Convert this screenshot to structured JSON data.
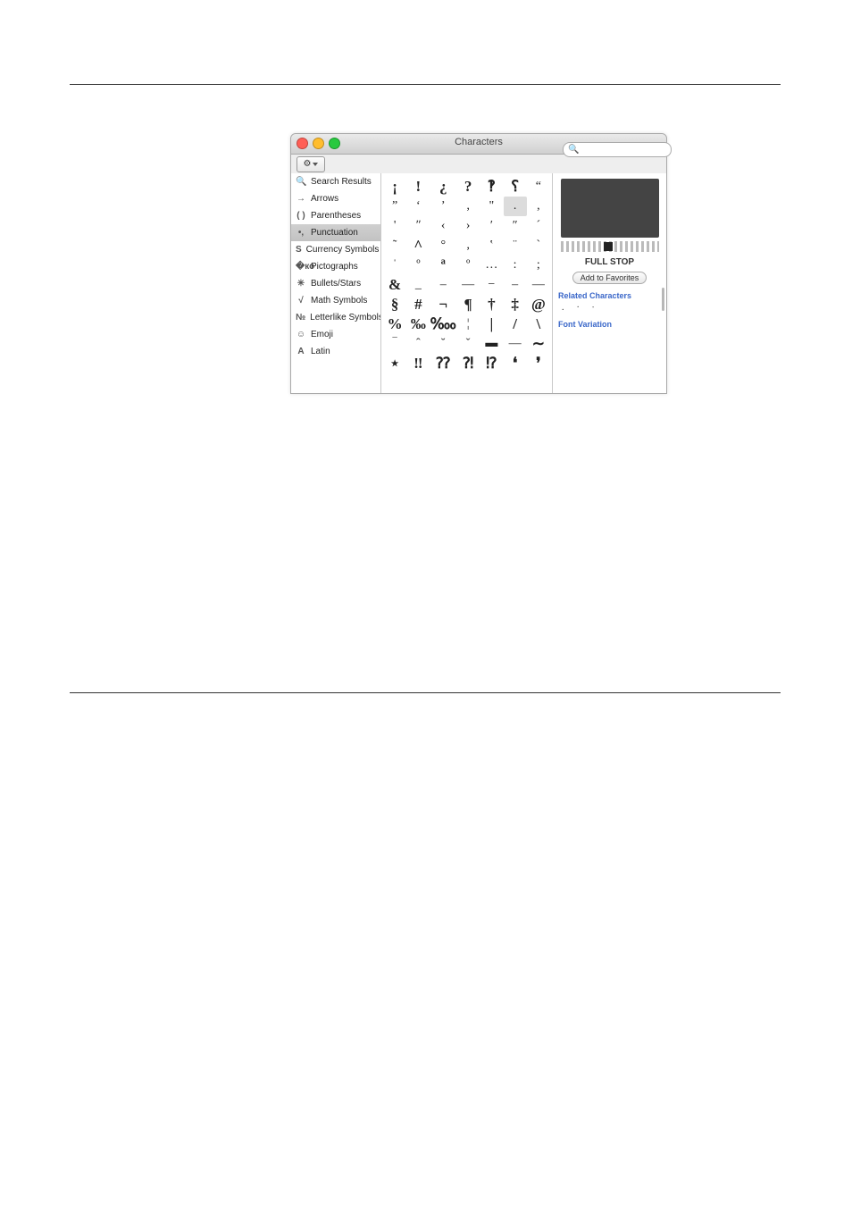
{
  "window": {
    "title": "Characters"
  },
  "search": {
    "placeholder": ""
  },
  "sidebar": {
    "items": [
      {
        "icon": "🔍",
        "label": "Search Results",
        "selected": false,
        "iconName": "search-icon"
      },
      {
        "icon": "→",
        "label": "Arrows",
        "selected": false,
        "iconName": "arrow-icon"
      },
      {
        "icon": "( )",
        "label": "Parentheses",
        "selected": false,
        "iconName": "parentheses-icon"
      },
      {
        "icon": "•,",
        "label": "Punctuation",
        "selected": true,
        "iconName": "punctuation-icon"
      },
      {
        "icon": "S",
        "label": "Currency Symbols",
        "selected": false,
        "iconName": "currency-icon"
      },
      {
        "icon": "�ко",
        "label": "Pictographs",
        "selected": false,
        "iconName": "pictograph-icon"
      },
      {
        "icon": "✳︎",
        "label": "Bullets/Stars",
        "selected": false,
        "iconName": "bullets-icon"
      },
      {
        "icon": "√",
        "label": "Math Symbols",
        "selected": false,
        "iconName": "math-icon"
      },
      {
        "icon": "№",
        "label": "Letterlike Symbols",
        "selected": false,
        "iconName": "letterlike-icon"
      },
      {
        "icon": "☺︎",
        "label": "Emoji",
        "selected": false,
        "iconName": "emoji-icon"
      },
      {
        "icon": "A",
        "label": "Latin",
        "selected": false,
        "iconName": "latin-icon"
      }
    ]
  },
  "grid": [
    {
      "c": "¡",
      "big": true
    },
    {
      "c": "!",
      "big": true
    },
    {
      "c": "¿",
      "big": true
    },
    {
      "c": "?",
      "big": true
    },
    {
      "c": "‽",
      "big": true
    },
    {
      "c": "⸮",
      "big": true
    },
    {
      "c": "“"
    },
    {
      "c": "”"
    },
    {
      "c": "‘"
    },
    {
      "c": "’"
    },
    {
      "c": "‚"
    },
    {
      "c": "\""
    },
    {
      "c": ".",
      "sel": true
    },
    {
      "c": ","
    },
    {
      "c": "'"
    },
    {
      "c": "ʺ"
    },
    {
      "c": "‹"
    },
    {
      "c": "›"
    },
    {
      "c": "′"
    },
    {
      "c": "″"
    },
    {
      "c": "´"
    },
    {
      "c": "˜"
    },
    {
      "c": "^",
      "big": true
    },
    {
      "c": "°"
    },
    {
      "c": "‚"
    },
    {
      "c": "‛"
    },
    {
      "c": "¨"
    },
    {
      "c": "`"
    },
    {
      "c": "ˈ"
    },
    {
      "c": "º"
    },
    {
      "c": "ª",
      "big": true
    },
    {
      "c": "º"
    },
    {
      "c": "…"
    },
    {
      "c": ":"
    },
    {
      "c": ";"
    },
    {
      "c": "&",
      "big": true
    },
    {
      "c": "_"
    },
    {
      "c": "–"
    },
    {
      "c": "—"
    },
    {
      "c": "−"
    },
    {
      "c": "‒"
    },
    {
      "c": "―"
    },
    {
      "c": "§",
      "big": true
    },
    {
      "c": "#",
      "big": true
    },
    {
      "c": "¬",
      "big": true
    },
    {
      "c": "¶",
      "big": true
    },
    {
      "c": "†",
      "big": true
    },
    {
      "c": "‡",
      "big": true
    },
    {
      "c": "@",
      "big": true
    },
    {
      "c": "%",
      "big": true
    },
    {
      "c": "‰",
      "big": true
    },
    {
      "c": "‱",
      "big": true
    },
    {
      "c": "¦"
    },
    {
      "c": "|",
      "big": true
    },
    {
      "c": "/",
      "big": true
    },
    {
      "c": "\\",
      "big": true
    },
    {
      "c": "‾"
    },
    {
      "c": "ˆ"
    },
    {
      "c": "˘"
    },
    {
      "c": "ˇ"
    },
    {
      "c": "▬"
    },
    {
      "c": "—"
    },
    {
      "c": "∼",
      "big": true
    },
    {
      "c": "⋆",
      "big": true
    },
    {
      "c": "‼",
      "big": true
    },
    {
      "c": "⁇",
      "big": true
    },
    {
      "c": "⁈",
      "big": true
    },
    {
      "c": "⁉",
      "big": true
    },
    {
      "c": "❛",
      "big": true
    },
    {
      "c": "❜",
      "big": true
    }
  ],
  "preview": {
    "name": "FULL STOP",
    "favorites_label": "Add to Favorites",
    "related_header": "Related Characters",
    "related": [
      ".",
      "·",
      "∙"
    ],
    "variation_header": "Font Variation"
  }
}
